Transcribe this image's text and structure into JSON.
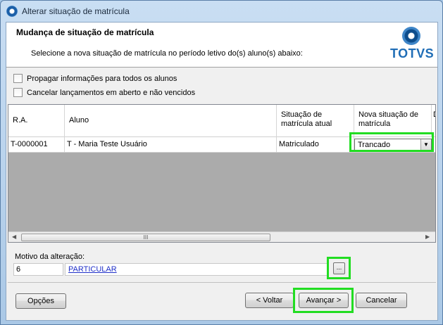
{
  "window": {
    "title": "Alterar situação de matrícula"
  },
  "header": {
    "title": "Mudança de situação de matrícula",
    "description": "Selecione a nova situação de matrícula no período letivo do(s) aluno(s) abaixo:",
    "logo_text": "TOTVS"
  },
  "options": {
    "propagate_label": "Propagar informações para todos os alunos",
    "cancel_label": "Cancelar lançamentos em aberto e não vencidos"
  },
  "grid": {
    "columns": [
      "R.A.",
      "Aluno",
      "Situação de matrícula atual",
      "Nova situação de matrícula",
      "D"
    ],
    "rows": [
      {
        "ra": "T-0000001",
        "aluno": "T - Maria Teste Usuário",
        "situacao_atual": "Matriculado",
        "nova_situacao": "Trancado"
      }
    ],
    "scroll_thumb": "III"
  },
  "motivo": {
    "label": "Motivo da alteração:",
    "code": "6",
    "description": "PARTICULAR",
    "lookup_label": "..."
  },
  "buttons": {
    "options": "Opções",
    "back": "< Voltar",
    "next": "Avançar >",
    "cancel": "Cancelar"
  },
  "colors": {
    "highlight": "#22dd22",
    "link": "#1f2fc8",
    "brand": "#1f6db6"
  }
}
